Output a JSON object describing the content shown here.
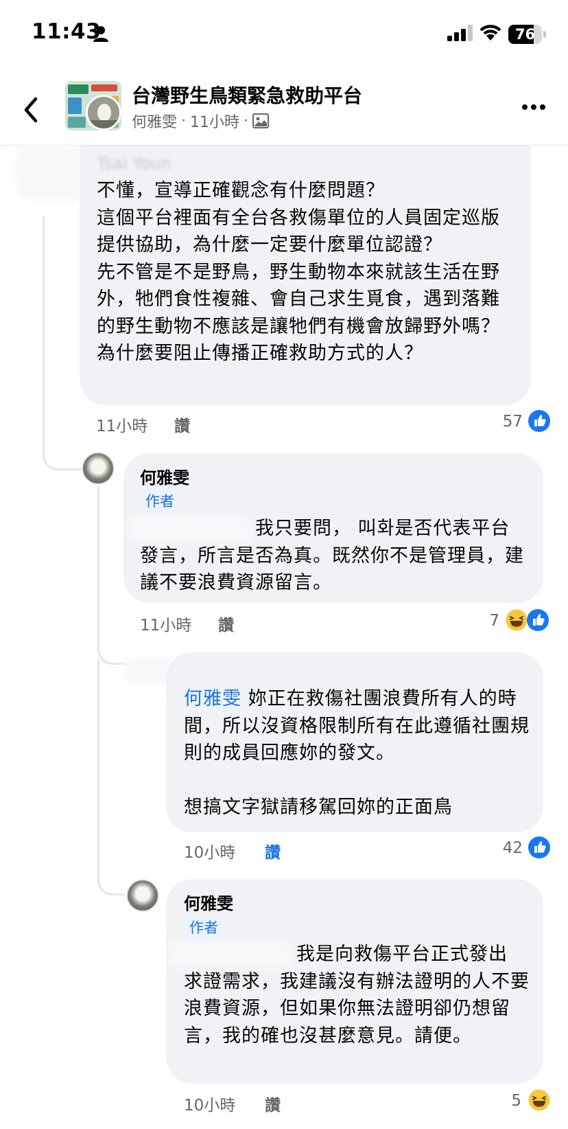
{
  "status_bar": {
    "time": "11:43",
    "battery": "76",
    "battery_level": 0.76,
    "icons": [
      "person-icon",
      "signal-icon",
      "wifi-icon",
      "battery-icon"
    ]
  },
  "header": {
    "group_name": "台灣野生鳥類緊急救助平台",
    "author": "何雅雯",
    "separator": "·",
    "time": "11小時",
    "icons": [
      "back-arrow-icon",
      "photo-icon",
      "more-icon"
    ]
  },
  "comments": [
    {
      "author_blurred": "Tsai Youn",
      "paragraphs": [
        "不懂，宣導正確觀念有什麼問題？",
        "這個平台裡面有全台各救傷單位的人員固定巡版提供協助，為什麼一定要什麼單位認證？",
        "先不管是不是野鳥，野生動物本來就該生活在野外，牠們食性複雜、會自己求生覓食，遇到落難的野生動物不應該是讓牠們有機會放歸野外嗎？",
        "為什麼要阻止傳播正確救助方式的人？"
      ],
      "time": "11小時",
      "like": "讚",
      "reactions": "57"
    },
    {
      "author": "何雅雯",
      "badge": "作者",
      "first_line": "我只要問， 叫화是否代表平台",
      "paragraphs": [
        "發言，所言是否為真。既然你不是管理員，建議不要浪費資源留言。"
      ],
      "time": "11小時",
      "like": "讚",
      "reactions": "7"
    },
    {
      "mention": "何雅雯",
      "mention_rest": " 妳正在救傷社團浪費所有人的時間，所以沒資格限制所有在此遵循社團規則的成員回應妳的發文。",
      "paragraphs": [
        "想搞文字獄請移駕回妳的正面鳥"
      ],
      "time": "10小時",
      "like": "讚",
      "reactions": "42"
    },
    {
      "author": "何雅雯",
      "badge": "作者",
      "first_line": "我是向救傷平台正式發出",
      "paragraphs": [
        "求證需求，我建議沒有辦法證明的人不要浪費資源，但如果你無法證明卻仍想留言，我的確也沒甚麼意見。請便。"
      ],
      "time": "10小時",
      "like": "讚",
      "reactions": "5"
    }
  ],
  "colors": {
    "bubble": "#f0f2f5",
    "secondary_text": "#65676b",
    "link_blue": "#1b74e4",
    "like_blue": "#1877f2",
    "haha_yellow": "#f7c83a"
  }
}
